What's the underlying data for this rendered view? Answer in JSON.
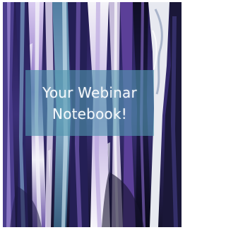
{
  "cover": {
    "title_line_1": "Your Webinar",
    "title_line_2": "Notebook!"
  },
  "colors": {
    "deep_navy": "#1b1840",
    "violet": "#6c4aa6",
    "lavender": "#c9b4e6",
    "teal_panel": "#5096af",
    "silver_white": "#eef0f4"
  }
}
